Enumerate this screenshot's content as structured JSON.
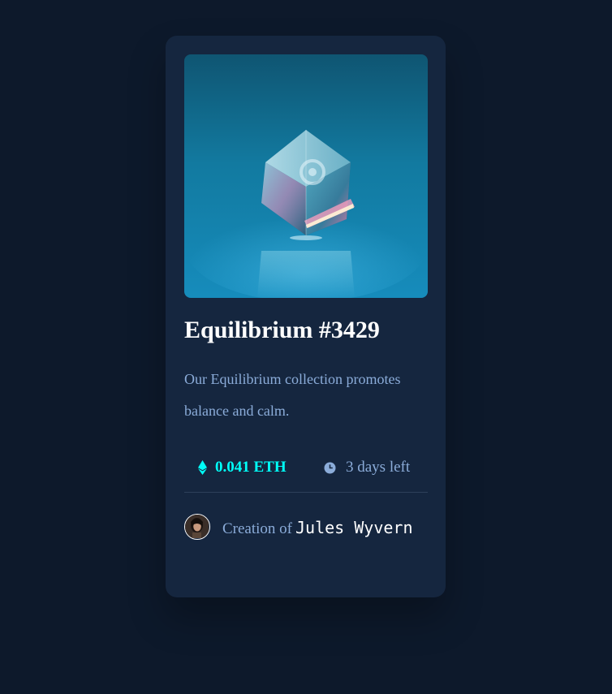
{
  "card": {
    "image_alt": "Equilibrium cube artwork",
    "title": "Equilibrium #3429",
    "description": "Our Equilibrium collection promotes balance and calm.",
    "price": "0.041 ETH",
    "price_icon": "ethereum-icon",
    "time_left": "3 days left",
    "time_icon": "clock-icon",
    "creator_prefix": "Creation of",
    "creator_name": "Jules Wyvern",
    "avatar": "creator-avatar"
  },
  "colors": {
    "page_background": "#0d192b",
    "card_background": "#15263f",
    "accent_cyan": "#00fff8",
    "soft_blue": "#8bacd9",
    "divider": "#2e405a",
    "white": "#ffffff"
  }
}
